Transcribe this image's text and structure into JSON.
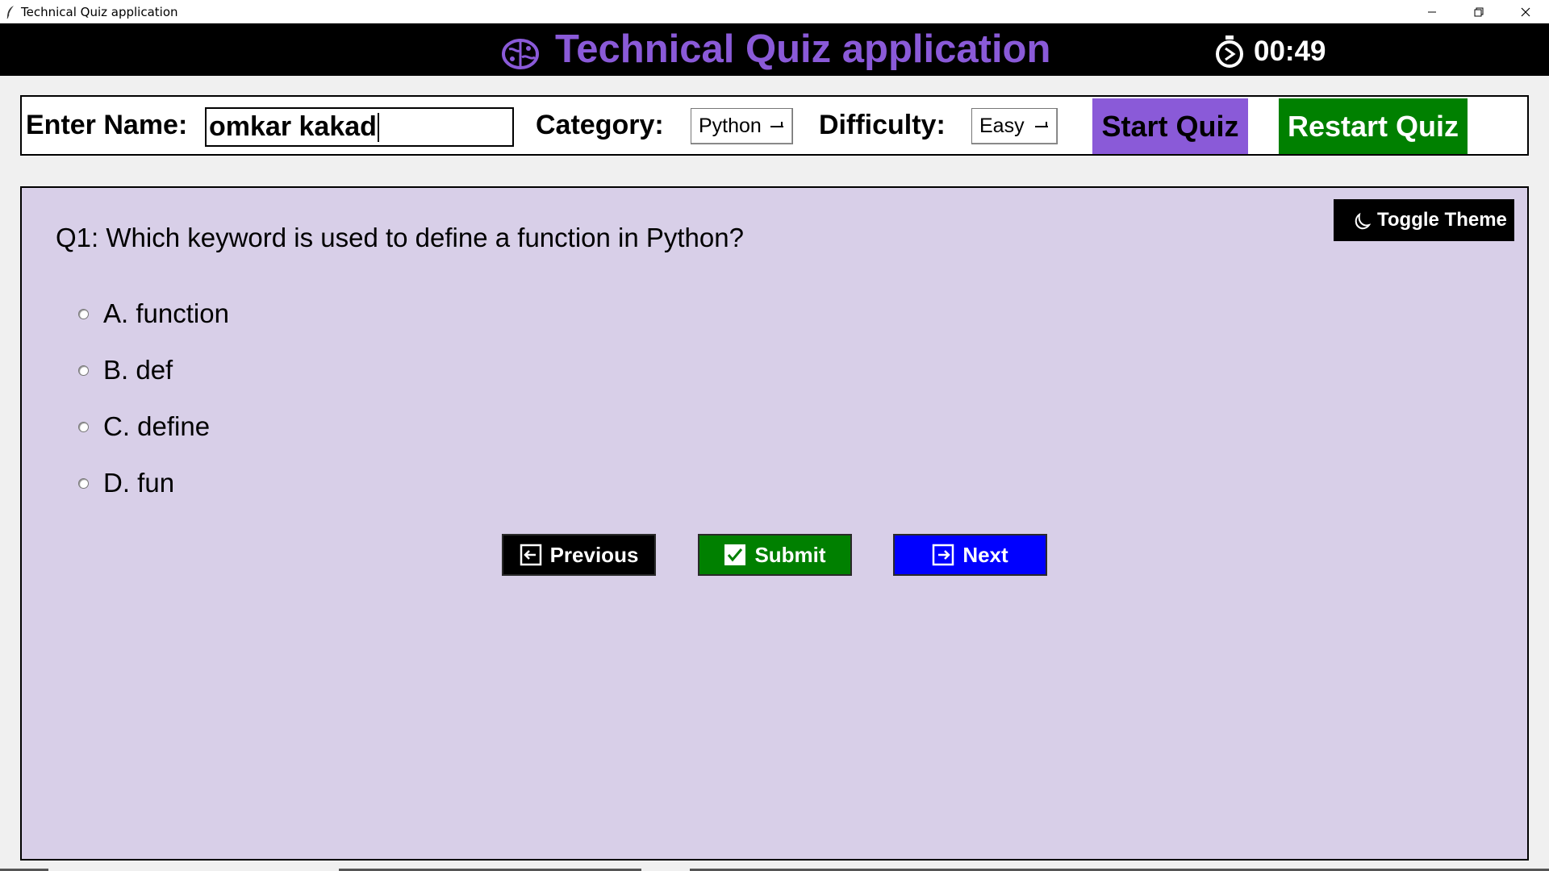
{
  "window": {
    "title": "Technical Quiz application"
  },
  "header": {
    "title": "Technical Quiz application",
    "timer": "00:49",
    "title_color": "#8a5ad8",
    "brain_icon": "brain-icon",
    "timer_icon": "stopwatch-icon"
  },
  "controls": {
    "name_label": "Enter Name:",
    "name_value": "omkar kakad",
    "category_label": "Category:",
    "category_value": "Python",
    "difficulty_label": "Difficulty:",
    "difficulty_value": "Easy",
    "start_label": "Start Quiz",
    "restart_label": "Restart Quiz",
    "start_color": "#8a5ad8",
    "restart_color": "#008000"
  },
  "quiz": {
    "toggle_label": "Toggle Theme",
    "question": "Q1: Which keyword is used to define a function in Python?",
    "options": [
      {
        "label": "A. function"
      },
      {
        "label": "B. def"
      },
      {
        "label": "C. define"
      },
      {
        "label": "D. fun"
      }
    ],
    "previous_label": "Previous",
    "submit_label": "Submit",
    "next_label": "Next",
    "background": "#d8cfe8"
  }
}
